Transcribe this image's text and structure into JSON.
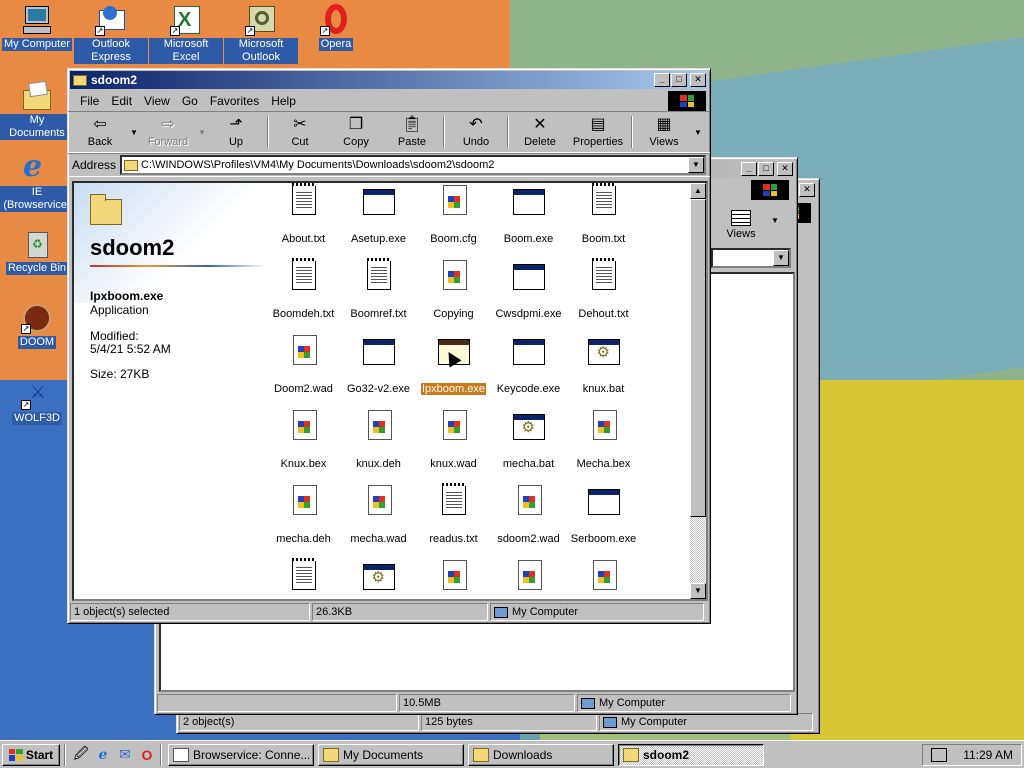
{
  "desktop": {
    "icons": [
      {
        "label": "My Computer",
        "icon": "computer-icon"
      },
      {
        "label": "Outlook Express",
        "icon": "outlook-express-icon"
      },
      {
        "label": "Microsoft Excel",
        "icon": "excel-icon"
      },
      {
        "label": "Microsoft Outlook",
        "icon": "outlook-icon"
      },
      {
        "label": "Opera",
        "icon": "opera-icon"
      },
      {
        "label": "My Documents",
        "icon": "documents-folder-icon"
      },
      {
        "label": "IE (Browservice)",
        "icon": "ie-icon"
      },
      {
        "label": "Recycle Bin",
        "icon": "recycle-bin-icon"
      },
      {
        "label": "DOOM",
        "icon": "doom-icon"
      },
      {
        "label": "WOLF3D",
        "icon": "wolf3d-icon"
      }
    ]
  },
  "back_window_1": {
    "toolbar_views": "Views",
    "status": {
      "size": "10.5MB",
      "zone": "My Computer"
    }
  },
  "back_window_2": {
    "status": {
      "objects": "2 object(s)",
      "size": "125 bytes",
      "zone": "My Computer"
    }
  },
  "main_window": {
    "title": "sdoom2",
    "menu": [
      "File",
      "Edit",
      "View",
      "Go",
      "Favorites",
      "Help"
    ],
    "toolbar": {
      "back": "Back",
      "forward": "Forward",
      "up": "Up",
      "cut": "Cut",
      "copy": "Copy",
      "paste": "Paste",
      "undo": "Undo",
      "delete": "Delete",
      "properties": "Properties",
      "views": "Views"
    },
    "address": {
      "label": "Address",
      "value": "C:\\WINDOWS\\Profiles\\VM4\\My Documents\\Downloads\\sdoom2\\sdoom2"
    },
    "info_pane": {
      "folder_name": "sdoom2",
      "selected_name": "Ipxboom.exe",
      "selected_type": "Application",
      "modified_label": "Modified:",
      "modified_value": "5/4/21 5:52 AM",
      "size": "Size: 27KB"
    },
    "files": [
      {
        "name": "About.txt",
        "type": "txt"
      },
      {
        "name": "Asetup.exe",
        "type": "exe"
      },
      {
        "name": "Boom.cfg",
        "type": "gen"
      },
      {
        "name": "Boom.exe",
        "type": "exe"
      },
      {
        "name": "Boom.txt",
        "type": "txt"
      },
      {
        "name": "Boomdeh.txt",
        "type": "txt"
      },
      {
        "name": "Boomref.txt",
        "type": "txt"
      },
      {
        "name": "Copying",
        "type": "gen"
      },
      {
        "name": "Cwsdpmi.exe",
        "type": "exe"
      },
      {
        "name": "Dehout.txt",
        "type": "txt"
      },
      {
        "name": "Doom2.wad",
        "type": "gen"
      },
      {
        "name": "Go32-v2.exe",
        "type": "exe"
      },
      {
        "name": "Ipxboom.exe",
        "type": "exe",
        "selected": true
      },
      {
        "name": "Keycode.exe",
        "type": "exe"
      },
      {
        "name": "knux.bat",
        "type": "bat"
      },
      {
        "name": "Knux.bex",
        "type": "gen"
      },
      {
        "name": "knux.deh",
        "type": "gen"
      },
      {
        "name": "knux.wad",
        "type": "gen"
      },
      {
        "name": "mecha.bat",
        "type": "bat"
      },
      {
        "name": "Mecha.bex",
        "type": "gen"
      },
      {
        "name": "mecha.deh",
        "type": "gen"
      },
      {
        "name": "mecha.wad",
        "type": "gen"
      },
      {
        "name": "readus.txt",
        "type": "txt"
      },
      {
        "name": "sdoom2.wad",
        "type": "gen"
      },
      {
        "name": "Serboom.exe",
        "type": "exe"
      },
      {
        "name": "",
        "type": "txt"
      },
      {
        "name": "",
        "type": "bat"
      },
      {
        "name": "",
        "type": "gen"
      },
      {
        "name": "",
        "type": "gen"
      },
      {
        "name": "",
        "type": "gen"
      }
    ],
    "status": {
      "objects": "1 object(s) selected",
      "size": "26.3KB",
      "zone": "My Computer"
    }
  },
  "taskbar": {
    "start": "Start",
    "quick_launch": [
      "desktop-icon",
      "ie-icon",
      "outlook-icon",
      "opera-icon"
    ],
    "tasks": [
      {
        "label": "Browservice: Conne...",
        "active": false
      },
      {
        "label": "My Documents",
        "active": false
      },
      {
        "label": "Downloads",
        "active": false
      },
      {
        "label": "sdoom2",
        "active": true
      }
    ],
    "clock": "11:29 AM"
  }
}
